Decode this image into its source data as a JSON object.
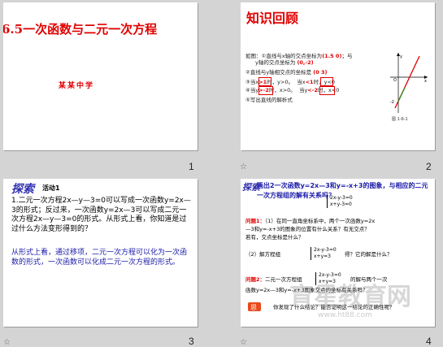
{
  "slides": [
    {
      "number": "1",
      "title": "6.5一次函数与二元一次方程",
      "school": "某某中学"
    },
    {
      "number": "2",
      "title": "知识回顾",
      "line1_a": "如图：①直线与x轴的交点坐标为",
      "line1_b": "(1.5 0)",
      "line1_c": "；与",
      "line2_a": "y轴的交点坐标为",
      "line2_b": "(0,-2)",
      "line3_a": "②直线与y轴相交点的坐标是",
      "line3_b": "(0 3)",
      "line4_a": "③当x",
      "line4_b": ">1",
      "line4_c": "时，y>0。",
      "line4_d": "当x",
      "line4_e": "<1",
      "line4_f": "时，y<0",
      "line5_a": "④当y",
      "line5_b": ">-2",
      "line5_c": "时，x>0。",
      "line5_d": "当y",
      "line5_e": "<-2",
      "line5_f": "时，x<0",
      "line6": "⑤写出直线的解析式",
      "caption": "图 1-6-1"
    },
    {
      "number": "3",
      "tag": "探索",
      "activity": "活动1",
      "para1": "1.二元一次方程2x—y—3=0可以写成一次函数y=2x—3的形式；反过来，一次函数y=2x—3可以写成二元一次方程2x—y—3=0的形式。从形式上看，你知道是过过什么方法变形得到的？",
      "para2": "从形式上看，通过移项，二元一次方程可以化为一次函数的形式，一次函数可以化成二元一次方程的形式。"
    },
    {
      "number": "4",
      "tag": "探索",
      "intro": "画出2一次函数y=2x—3和y=-x+3的图象，与相应的二元一次方程组的解有关系吗？",
      "sys_top1": "2x-y-3=0",
      "sys_top2": "x+y-3=0",
      "q1_label": "问题1：",
      "q1_a": "（1）在同一直角坐标系中，两个一次函数y=2x",
      "q1_b": "—3和y=-x+3的图象的位置有什么关系？有无交点？",
      "q1_c": "若有，交点坐标是什么？",
      "q2_a": "（2）解方程组",
      "sys_mid1": "2x-y-3=0",
      "sys_mid2": "x+y=3",
      "q2_b": "得？它的解是什么？",
      "q3_label": "问题2：",
      "q3_a": "二元一次方程组",
      "sys_bot1": "2x-y-3=0",
      "sys_bot2": "x+y=3",
      "q3_b": "的解与两个一次",
      "q3_c": "函数y=2x—3和y=-x+3图象交点的坐标有关系吗？",
      "bottom": "你发现了什么结论？能否证明这一结论的正确性呢？",
      "watermark": "育星教育网",
      "watermark_url": "www.ht88.com"
    }
  ],
  "colors": {
    "accent_red": "#e00000",
    "blue_text": "#1a1aa8",
    "background": "#d4d4d4"
  }
}
